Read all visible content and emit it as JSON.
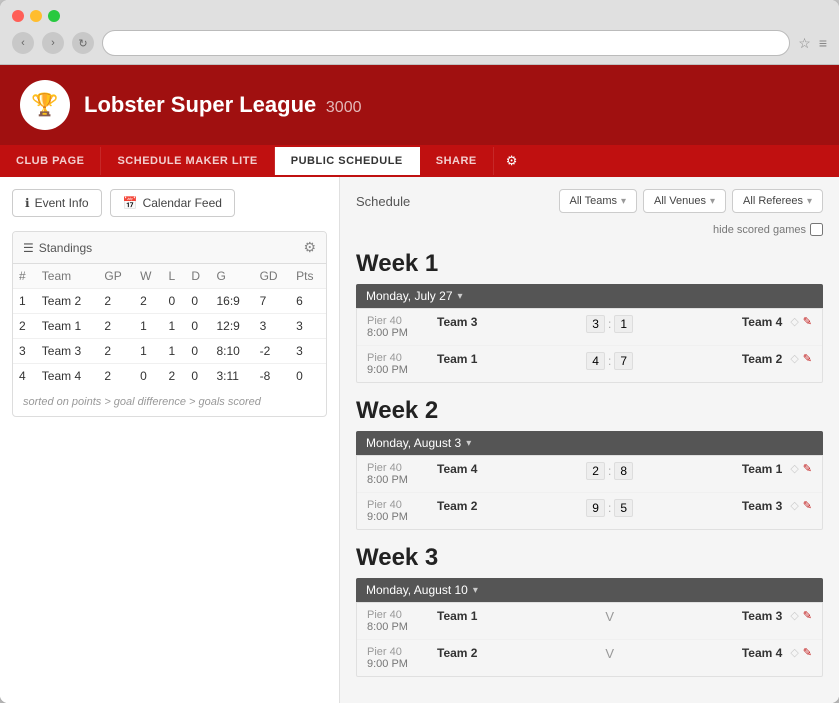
{
  "browser": {
    "url": ""
  },
  "league": {
    "name": "Lobster Super League",
    "number": "3000",
    "logo_icon": "🏆"
  },
  "nav": {
    "tabs": [
      {
        "id": "club-page",
        "label": "CLUB PAGE"
      },
      {
        "id": "schedule-maker",
        "label": "SCHEDULE MAKER LITE"
      },
      {
        "id": "public-schedule",
        "label": "PUBLIC SCHEDULE",
        "active": true
      },
      {
        "id": "share",
        "label": "SHARE"
      },
      {
        "id": "settings",
        "label": "⚙"
      }
    ]
  },
  "toolbar": {
    "event_info_label": "Event Info",
    "calendar_feed_label": "Calendar Feed",
    "all_teams_label": "All Teams",
    "all_venues_label": "All Venues",
    "all_referees_label": "All Referees",
    "hide_scored_label": "hide scored games"
  },
  "standings": {
    "title": "Standings",
    "columns": [
      "#",
      "Team",
      "GP",
      "W",
      "L",
      "D",
      "G",
      "GD",
      "Pts"
    ],
    "rows": [
      {
        "rank": 1,
        "team": "Team 2",
        "gp": 2,
        "w": 2,
        "l": 0,
        "d": 0,
        "g": "16:9",
        "gd": 7,
        "pts": 6
      },
      {
        "rank": 2,
        "team": "Team 1",
        "gp": 2,
        "w": 1,
        "l": 1,
        "d": 0,
        "g": "12:9",
        "gd": 3,
        "pts": 3
      },
      {
        "rank": 3,
        "team": "Team 3",
        "gp": 2,
        "w": 1,
        "l": 1,
        "d": 0,
        "g": "8:10",
        "gd": -2,
        "pts": 3
      },
      {
        "rank": 4,
        "team": "Team 4",
        "gp": 2,
        "w": 0,
        "l": 2,
        "d": 0,
        "g": "3:11",
        "gd": -8,
        "pts": 0
      }
    ],
    "note": "sorted on points > goal difference > goals scored"
  },
  "schedule": {
    "title": "Schedule",
    "weeks": [
      {
        "label": "Week 1",
        "days": [
          {
            "label": "Monday, July 27",
            "games": [
              {
                "venue": "Pier 40",
                "time": "8:00 PM",
                "home": "Team 3",
                "score_home": "3",
                "score_away": "1",
                "away": "Team 4"
              },
              {
                "venue": "Pier 40",
                "time": "9:00 PM",
                "home": "Team 1",
                "score_home": "4",
                "score_away": "7",
                "away": "Team 2"
              }
            ]
          }
        ]
      },
      {
        "label": "Week 2",
        "days": [
          {
            "label": "Monday, August 3",
            "games": [
              {
                "venue": "Pier 40",
                "time": "8:00 PM",
                "home": "Team 4",
                "score_home": "2",
                "score_away": "8",
                "away": "Team 1"
              },
              {
                "venue": "Pier 40",
                "time": "9:00 PM",
                "home": "Team 2",
                "score_home": "9",
                "score_away": "5",
                "away": "Team 3"
              }
            ]
          }
        ]
      },
      {
        "label": "Week 3",
        "days": [
          {
            "label": "Monday, August 10",
            "games": [
              {
                "venue": "Pier 40",
                "time": "8:00 PM",
                "home": "Team 1",
                "score_home": "V",
                "score_away": null,
                "away": "Team 3"
              },
              {
                "venue": "Pier 40",
                "time": "9:00 PM",
                "home": "Team 2",
                "score_home": "V",
                "score_away": null,
                "away": "Team 4"
              }
            ]
          }
        ]
      }
    ]
  }
}
